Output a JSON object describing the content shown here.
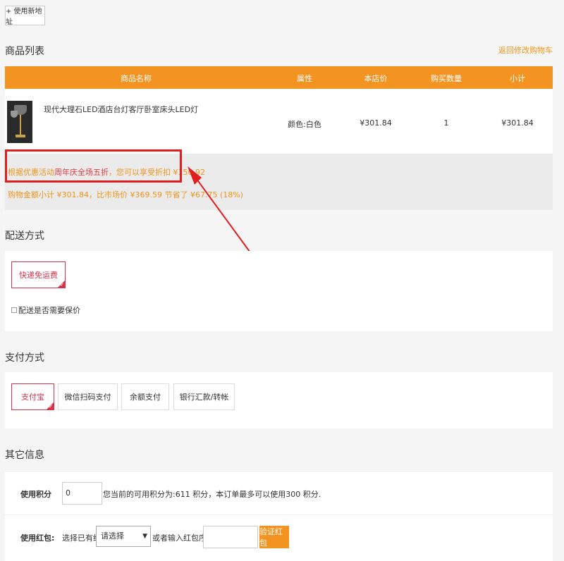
{
  "address": {
    "new_button": "+ 使用新地址"
  },
  "goods": {
    "title": "商品列表",
    "back_link": "返回修改购物车",
    "columns": [
      "商品名称",
      "属性",
      "本店价",
      "购买数量",
      "小计"
    ],
    "item": {
      "name": "现代大理石LED酒店台灯客厅卧室床头LED灯",
      "attr": "颜色:白色",
      "price": "¥301.84",
      "qty": "1",
      "subtotal": "¥301.84"
    },
    "promo": {
      "prefix": "根据优惠活动",
      "highlight": "周年庆全场五折",
      "suffix": "，您可以享受折扣 ¥150.92"
    },
    "summary": "购物金额小计 ¥301.84，比市场价 ¥369.59 节省了 ¥67.75 (18%)"
  },
  "shipping": {
    "title": "配送方式",
    "option": "快递免运费",
    "insure_label": "配送是否需要保价"
  },
  "payment": {
    "title": "支付方式",
    "options": [
      "支付宝",
      "微信扫码支付",
      "余额支付",
      "银行汇款/转帐"
    ]
  },
  "other": {
    "title": "其它信息",
    "points_label": "使用积分",
    "points_value": "0",
    "points_hint": "您当前的可用积分为:611 积分，本订单最多可以使用300 积分.",
    "bonus_label": "使用红包:",
    "bonus_choose": "选择已有红包",
    "bonus_select": "请选择",
    "bonus_or": "或者输入红包序列号",
    "bonus_verify": "验证红包"
  },
  "colors": {
    "accent": "#f39422",
    "selected": "#d8324a",
    "annotation": "#e02020"
  },
  "icons": {
    "selected_mark": "check-corner-icon",
    "annotation_arrow": "arrow-icon"
  }
}
